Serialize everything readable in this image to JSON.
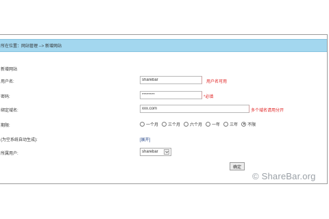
{
  "breadcrumb": "所在位置：网站管理 --> 新增网站",
  "section_title": "新增网站",
  "form": {
    "username": {
      "label": "用户名:",
      "value": "sharebar",
      "hint": "用户名可用"
    },
    "password": {
      "label": "密码:",
      "value": "********",
      "hint": "*必填"
    },
    "domain": {
      "label": "绑定域名:",
      "value": "xxx.com",
      "hint": "多个域名请用分开"
    },
    "period": {
      "label": "期限:",
      "options": [
        "一个月",
        "三个月",
        "六个月",
        "一年",
        "三年",
        "不限"
      ],
      "selected": "不限"
    },
    "default_site": {
      "label": "(为空系统自动生成):",
      "link": "[展开]"
    },
    "owner": {
      "label": "所属用户:",
      "selected": "sharebar"
    },
    "submit_label": "确定"
  },
  "watermark": "© ShareBar.org"
}
